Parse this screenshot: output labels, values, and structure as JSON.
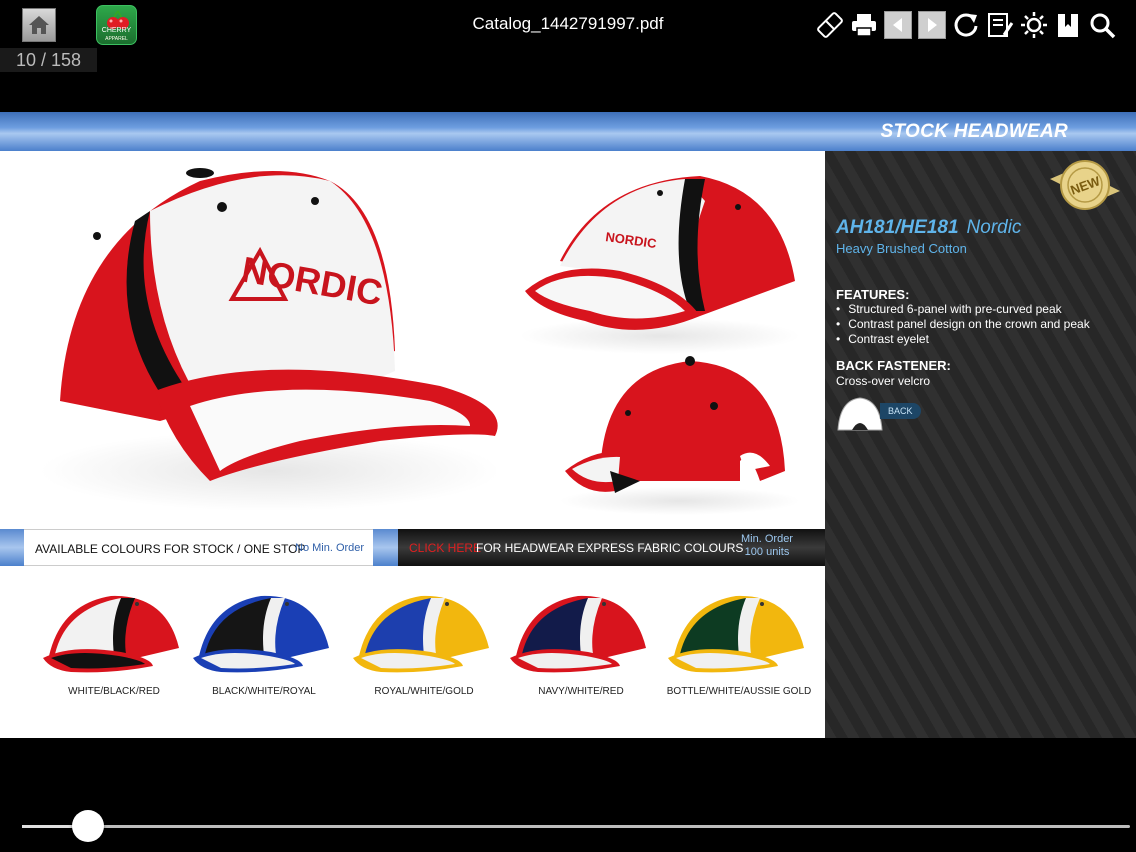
{
  "viewer": {
    "title": "Catalog_1442791997.pdf",
    "page_counter": "10 / 158",
    "logo_text": "CHERRY",
    "logo_subtext": "APPAREL",
    "reading_progress": 0.06
  },
  "toolbar": {
    "icons": [
      "home-icon",
      "link-icon",
      "print-icon",
      "previous-page-icon",
      "next-page-icon",
      "refresh-icon",
      "notes-icon",
      "brightness-icon",
      "bookmark-icon",
      "search-icon"
    ]
  },
  "page": {
    "banner_title": "STOCK HEADWEAR",
    "badge_text": "NEW",
    "product": {
      "code": "AH181/HE181",
      "name": "Nordic",
      "material": "Heavy Brushed Cotton",
      "features_title": "FEATURES:",
      "features": [
        "Structured 6-panel with pre-curved peak",
        "Contrast panel design on the crown and peak",
        "Contrast eyelet"
      ],
      "back_fastener_title": "BACK FASTENER:",
      "back_fastener": "Cross-over velcro",
      "back_label": "BACK",
      "cap_logo_text": "NORDIC"
    },
    "colour_strip": {
      "available": "AVAILABLE COLOURS FOR  STOCK / ONE STOP",
      "no_min": "No Min. Order",
      "click_here": "CLICK HERE",
      "express": "FOR  HEADWEAR EXPRESS FABRIC COLOURS",
      "min_order_line1": "Min. Order",
      "min_order_line2": "100 units"
    },
    "swatches": [
      {
        "label": "WHITE/BLACK/RED",
        "colors": [
          "#f2f2f2",
          "#111111",
          "#d8141d"
        ]
      },
      {
        "label": "BLACK/WHITE/ROYAL",
        "colors": [
          "#151515",
          "#f0f0f0",
          "#1a3fb5"
        ]
      },
      {
        "label": "ROYAL/WHITE/GOLD",
        "colors": [
          "#1d3fae",
          "#f0f0f0",
          "#f2b70e"
        ]
      },
      {
        "label": "NAVY/WHITE/RED",
        "colors": [
          "#121b4a",
          "#f0f0f0",
          "#d8141d"
        ]
      },
      {
        "label": "BOTTLE/WHITE/AUSSIE GOLD",
        "colors": [
          "#0d3b22",
          "#f0f0f0",
          "#f2b70e"
        ]
      }
    ]
  }
}
